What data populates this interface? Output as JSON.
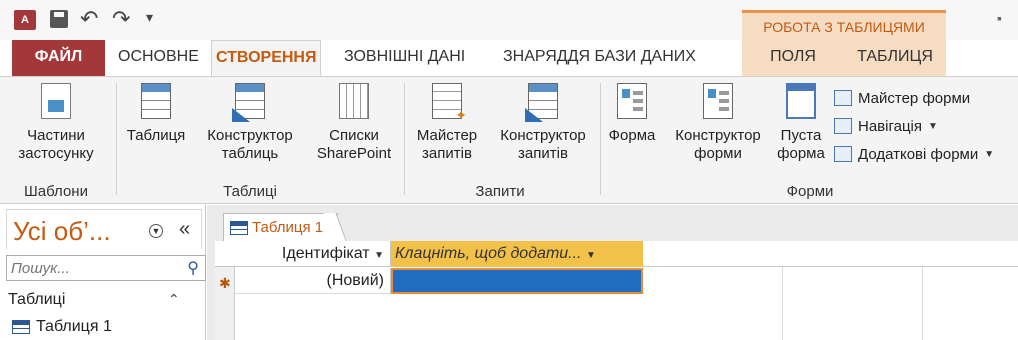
{
  "colors": {
    "brand": "#a4373a",
    "accent": "#c55a11",
    "context_band": "#f6dcc3",
    "add_column_header": "#f2c14a",
    "selected_cell": "#1f6cc0"
  },
  "quick_access": {
    "app_icon": "A",
    "icons": [
      "save-icon",
      "undo-icon",
      "redo-icon"
    ]
  },
  "context_group": {
    "label": "РОБОТА З ТАБЛИЦЯМИ"
  },
  "tabs": {
    "file": "ФАЙЛ",
    "home": "ОСНОВНЕ",
    "create": "СТВОРЕННЯ",
    "external": "ЗОВНІШНІ ДАНІ",
    "dbtools": "ЗНАРЯДДЯ БАЗИ ДАНИХ",
    "fields": "ПОЛЯ",
    "table": "ТАБЛИЦЯ"
  },
  "ribbon": {
    "templates": {
      "btn_line1": "Частини",
      "btn_line2": "застосунку",
      "group": "Шаблони"
    },
    "tables": {
      "table": "Таблиця",
      "designer_line1": "Конструктор",
      "designer_line2": "таблиць",
      "lists_line1": "Списки",
      "lists_line2": "SharePoint",
      "group": "Таблиці"
    },
    "queries": {
      "wizard_line1": "Майстер",
      "wizard_line2": "запитів",
      "designer_line1": "Конструктор",
      "designer_line2": "запитів",
      "group": "Запити"
    },
    "forms": {
      "form": "Форма",
      "designer_line1": "Конструктор",
      "designer_line2": "форми",
      "blank_line1": "Пуста",
      "blank_line2": "форма",
      "wizard": "Майстер форми",
      "navigation": "Навігація",
      "more": "Додаткові форми",
      "group": "Форми"
    }
  },
  "nav": {
    "title": "Усі об’...",
    "search_placeholder": "Пошук...",
    "group": "Таблиці",
    "items": [
      "Таблиця 1"
    ]
  },
  "document": {
    "tab": "Таблиця 1",
    "columns": [
      "Ідентифікат",
      "Клацніть, щоб додати..."
    ],
    "new_row": "(Новий)"
  }
}
